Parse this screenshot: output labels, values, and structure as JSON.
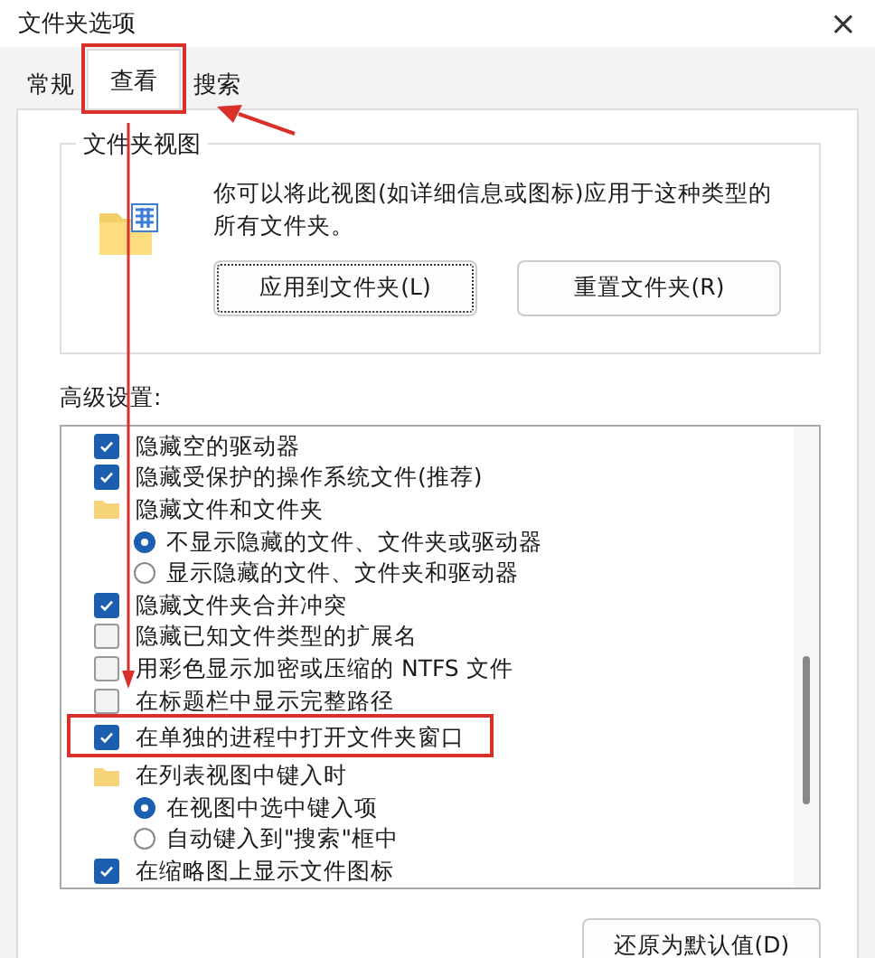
{
  "window": {
    "title": "文件夹选项",
    "close": "×"
  },
  "tabs": [
    {
      "label": "常规",
      "selected": false,
      "annotated": false
    },
    {
      "label": "查看",
      "selected": true,
      "annotated": true
    },
    {
      "label": "搜索",
      "selected": false,
      "annotated": false
    }
  ],
  "folder_views": {
    "title": "文件夹视图",
    "description": "你可以将此视图(如详细信息或图标)应用于这种类型的所有文件夹。",
    "buttons": [
      {
        "label": "应用到文件夹(L)",
        "focused": true
      },
      {
        "label": "重置文件夹(R)",
        "focused": false
      }
    ]
  },
  "advanced": {
    "label": "高级设置:",
    "items": [
      {
        "kind": "checkbox",
        "label": "隐藏空的驱动器",
        "checked": true,
        "annotated": false
      },
      {
        "kind": "checkbox",
        "label": "隐藏受保护的操作系统文件(推荐)",
        "checked": true,
        "annotated": false
      },
      {
        "kind": "folder",
        "label": "隐藏文件和文件夹",
        "children": [
          {
            "label": "不显示隐藏的文件、文件夹或驱动器",
            "selected": true
          },
          {
            "label": "显示隐藏的文件、文件夹和驱动器",
            "selected": false
          }
        ]
      },
      {
        "kind": "checkbox",
        "label": "隐藏文件夹合并冲突",
        "checked": true,
        "annotated": false
      },
      {
        "kind": "checkbox",
        "label": "隐藏已知文件类型的扩展名",
        "checked": false,
        "annotated": false
      },
      {
        "kind": "checkbox",
        "label": "用彩色显示加密或压缩的 NTFS 文件",
        "checked": false,
        "annotated": false
      },
      {
        "kind": "checkbox",
        "label": "在标题栏中显示完整路径",
        "checked": false,
        "annotated": false
      },
      {
        "kind": "checkbox",
        "label": "在单独的进程中打开文件夹窗口",
        "checked": true,
        "annotated": true
      },
      {
        "kind": "folder",
        "label": "在列表视图中键入时",
        "children": [
          {
            "label": "在视图中选中键入项",
            "selected": true
          },
          {
            "label": "自动键入到\"搜索\"框中",
            "selected": false
          }
        ]
      },
      {
        "kind": "checkbox",
        "label": "在缩略图上显示文件图标",
        "checked": true,
        "annotated": false
      }
    ]
  },
  "restore_button": "还原为默认值(D)"
}
